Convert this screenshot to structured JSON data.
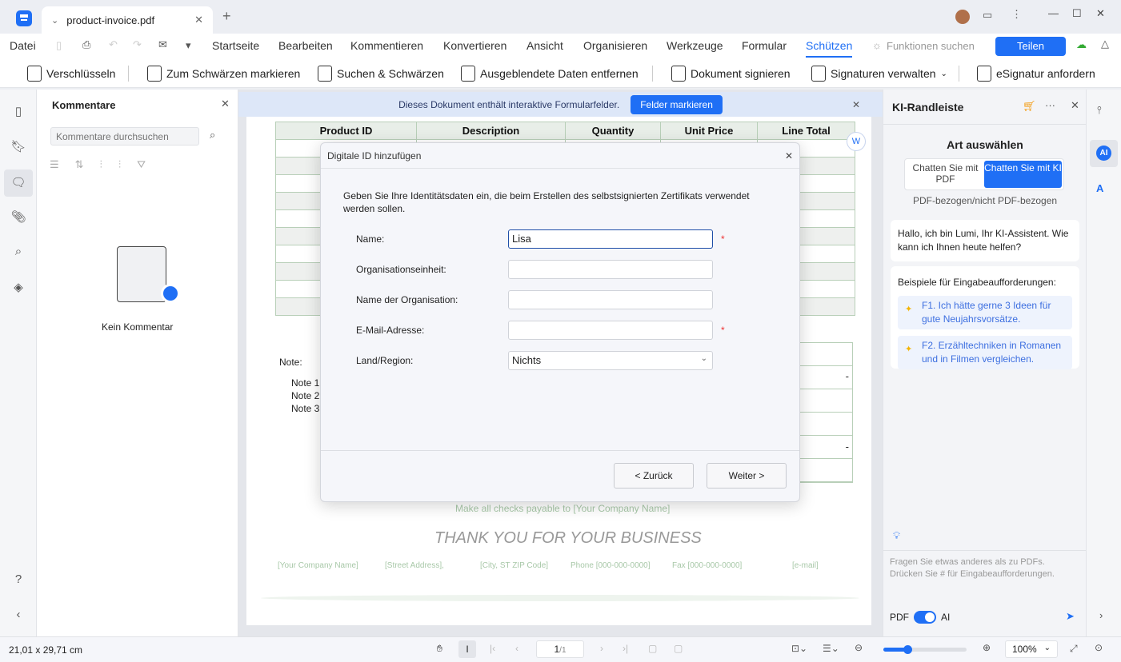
{
  "titlebar": {
    "tab_title": "product-invoice.pdf"
  },
  "menu": {
    "file": "Datei",
    "items": [
      "Startseite",
      "Bearbeiten",
      "Kommentieren",
      "Konvertieren",
      "Ansicht",
      "Organisieren",
      "Werkzeuge",
      "Formular",
      "Schützen"
    ],
    "active": "Schützen",
    "search": "Funktionen suchen",
    "share": "Teilen"
  },
  "ribbon": {
    "items": [
      "Verschlüsseln",
      "Zum Schwärzen markieren",
      "Suchen & Schwärzen",
      "Ausgeblendete Daten entfernen",
      "Dokument signieren",
      "Signaturen verwalten",
      "eSignatur anfordern"
    ]
  },
  "comments": {
    "title": "Kommentare",
    "search_placeholder": "Kommentare durchsuchen",
    "empty": "Kein Kommentar"
  },
  "banner": {
    "text": "Dieses Dokument enthält interaktive Formularfelder.",
    "button": "Felder markieren"
  },
  "invoice": {
    "headers": [
      "Product ID",
      "Description",
      "Quantity",
      "Unit Price",
      "Line Total"
    ],
    "note_label": "Note:",
    "notes": [
      "Note 1",
      "Note 2",
      "Note 3"
    ],
    "dash": "-",
    "checks": "Make all checks payable to [Your Company Name]",
    "thanks": "THANK YOU FOR YOUR BUSINESS",
    "footer": [
      "[Your Company Name]",
      "[Street Address],",
      "[City, ST ZIP Code]",
      "Phone [000-000-0000]",
      "Fax [000-000-0000]",
      "[e-mail]"
    ]
  },
  "dialog": {
    "title": "Digitale ID hinzufügen",
    "intro": "Geben Sie Ihre Identitätsdaten ein, die beim Erstellen des selbstsignierten Zertifikats verwendet werden sollen.",
    "fields": [
      {
        "label": "Name:",
        "value": "Lisa",
        "required": "*"
      },
      {
        "label": "Organisationseinheit:",
        "value": ""
      },
      {
        "label": "Name der Organisation:",
        "value": ""
      },
      {
        "label": "E-Mail-Adresse:",
        "value": "",
        "required": "*"
      },
      {
        "label": "Land/Region:",
        "value": "Nichts"
      }
    ],
    "back": "< Zurück",
    "next": "Weiter >"
  },
  "ai": {
    "title": "KI-Randleiste",
    "select_title": "Art auswählen",
    "opt_pdf": "Chatten Sie mit PDF",
    "opt_ki": "Chatten Sie mit KI",
    "subtitle": "PDF-bezogen/nicht PDF-bezogen",
    "greeting": "Hallo, ich bin Lumi, Ihr KI-Assistent. Wie kann ich Ihnen heute helfen?",
    "examples_title": "Beispiele für Eingabeaufforderungen:",
    "examples": [
      "F1. Ich hätte gerne 3 Ideen für gute Neujahrsvorsätze.",
      "F2. Erzähltechniken in Romanen und in Filmen vergleichen."
    ],
    "input_placeholder": "Fragen Sie etwas anderes als zu PDFs. Drücken Sie # für Eingabeaufforderungen.",
    "toggle_pdf": "PDF",
    "toggle_ai": "AI",
    "toggle_on": true,
    "accent": "#1f6ff5"
  },
  "status": {
    "size": "21,01 x 29,71 cm",
    "page": "1",
    "pages": "/1",
    "zoom": "100%",
    "zoom_fraction": 0.3
  }
}
